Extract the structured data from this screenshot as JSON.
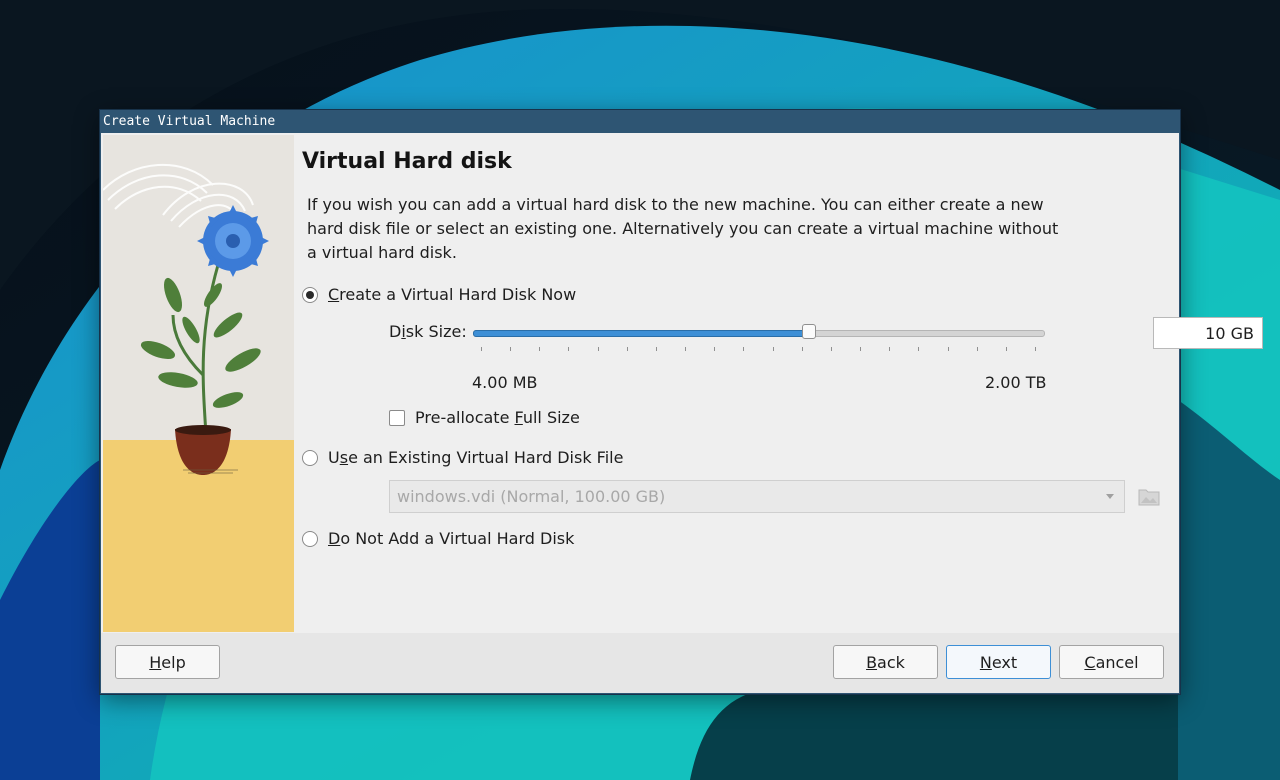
{
  "window": {
    "title": "Create Virtual Machine"
  },
  "page": {
    "heading": "Virtual Hard disk",
    "description": "If you wish you can add a virtual hard disk to the new machine. You can either create a new hard disk file or select an existing one. Alternatively you can create a virtual machine without a virtual hard disk."
  },
  "options": {
    "create_new": {
      "mnemonic": "C",
      "rest": "reate a Virtual Hard Disk Now",
      "selected": true
    },
    "use_existing": {
      "pre": "U",
      "mnemonic": "s",
      "rest": "e an Existing Virtual Hard Disk File",
      "selected": false
    },
    "none": {
      "mnemonic": "D",
      "rest": "o Not Add a Virtual Hard Disk",
      "selected": false
    }
  },
  "disk_size": {
    "label_pre": "D",
    "label_mnemonic": "i",
    "label_rest": "sk Size:",
    "value": "10 GB",
    "min_label": "4.00 MB",
    "max_label": "2.00 TB",
    "slider_fraction": 0.59
  },
  "preallocate": {
    "label_pre": "Pre-allocate ",
    "mnemonic": "F",
    "rest": "ull Size",
    "checked": false
  },
  "existing_file": {
    "value": "windows.vdi (Normal, 100.00 GB)"
  },
  "buttons": {
    "help": {
      "mnemonic": "H",
      "rest": "elp"
    },
    "back": {
      "mnemonic": "B",
      "rest": "ack"
    },
    "next": {
      "mnemonic": "N",
      "rest": "ext"
    },
    "cancel": {
      "mnemonic": "C",
      "rest": "ancel"
    }
  },
  "colors": {
    "titlebar": "#2e5573",
    "accent": "#3d8fd6",
    "window_bg": "#efefef"
  }
}
